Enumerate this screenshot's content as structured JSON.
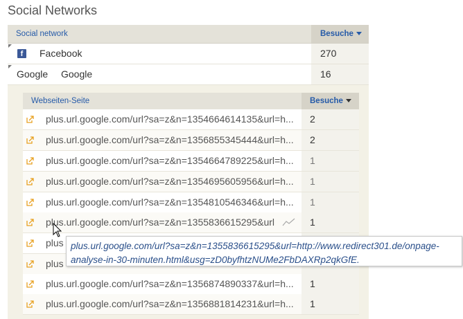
{
  "title": "Social Networks",
  "social_table": {
    "col_network": "Social network",
    "col_visits": "Besuche",
    "rows": [
      {
        "label": "Facebook",
        "visits": "270",
        "icon": "facebook-icon"
      },
      {
        "logo": "Google",
        "label": "Google",
        "visits": "16",
        "icon": "google-logo"
      }
    ]
  },
  "sub_table": {
    "col_page": "Webseiten-Seite",
    "col_visits": "Besuche",
    "rows": [
      {
        "url": "plus.url.google.com/url?sa=z&n=1354664614135&url=h...",
        "visits": "2"
      },
      {
        "url": "plus.url.google.com/url?sa=z&n=1356855345444&url=h...",
        "visits": "2"
      },
      {
        "url": "plus.url.google.com/url?sa=z&n=1354664789225&url=h...",
        "visits": "1"
      },
      {
        "url": "plus.url.google.com/url?sa=z&n=1354695605956&url=h...",
        "visits": "1"
      },
      {
        "url": "plus.url.google.com/url?sa=z&n=1354810546346&url=h...",
        "visits": "1"
      },
      {
        "url": "plus.url.google.com/url?sa=z&n=1355836615295&url",
        "visits": "1"
      },
      {
        "url": "plus",
        "visits": ""
      },
      {
        "url": "plus",
        "visits": ""
      },
      {
        "url": "plus.url.google.com/url?sa=z&n=1356874890337&url=h...",
        "visits": "1"
      },
      {
        "url": "plus.url.google.com/url?sa=z&n=1356881814231&url=h...",
        "visits": "1"
      }
    ]
  },
  "tooltip": {
    "line1": "plus.url.google.com/url?sa=z&n=1355836615295&url=http://www.redirect301.de/onpage-",
    "line2": "analyse-in-30-minuten.html&usg=zD0byfhtzNUMe2FbDAXRp2qkGfE."
  },
  "colors": {
    "header_bg": "#e4e2d9",
    "header_text": "#255aa8",
    "facebook": "#3b5998",
    "link_icon": "#e8a020",
    "tooltip_text": "#2a4f8a"
  }
}
